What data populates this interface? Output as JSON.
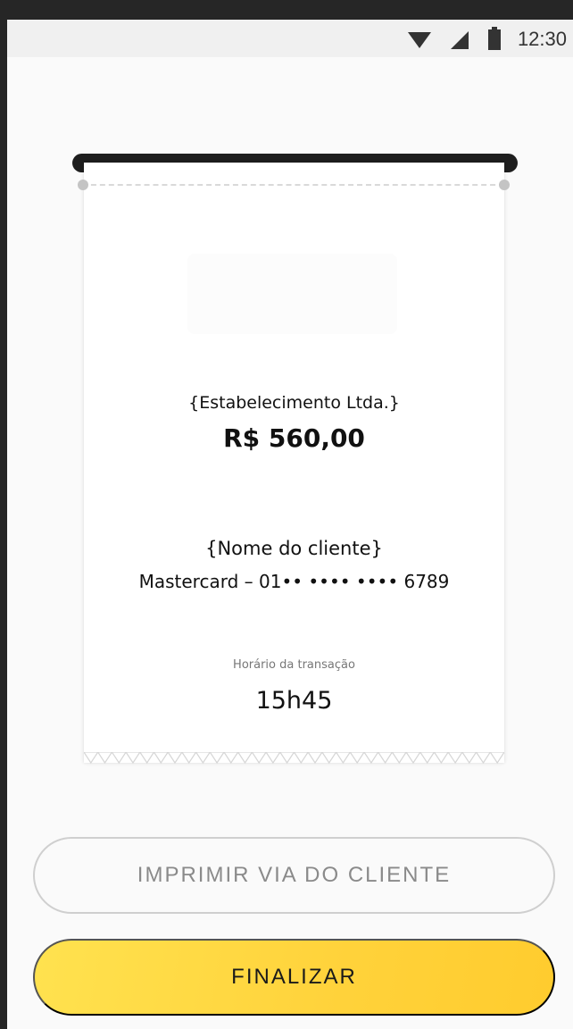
{
  "status_bar": {
    "time": "12:30",
    "icons": [
      "wifi-icon",
      "signal-icon",
      "battery-icon"
    ]
  },
  "receipt": {
    "merchant_name": "{Estabelecimento Ltda.}",
    "amount": "R$ 560,00",
    "customer_name": "{Nome do cliente}",
    "card_info": "Mastercard – 01•• •••• •••• 6789",
    "transaction_time_label": "Horário da transação",
    "transaction_time": "15h45"
  },
  "actions": {
    "print_customer_copy_label": "IMPRIMIR VIA DO CLIENTE",
    "finish_label": "FINALIZAR"
  },
  "colors": {
    "accent": "#FFD23A",
    "frame": "#262626",
    "background": "#FAFAFA"
  }
}
